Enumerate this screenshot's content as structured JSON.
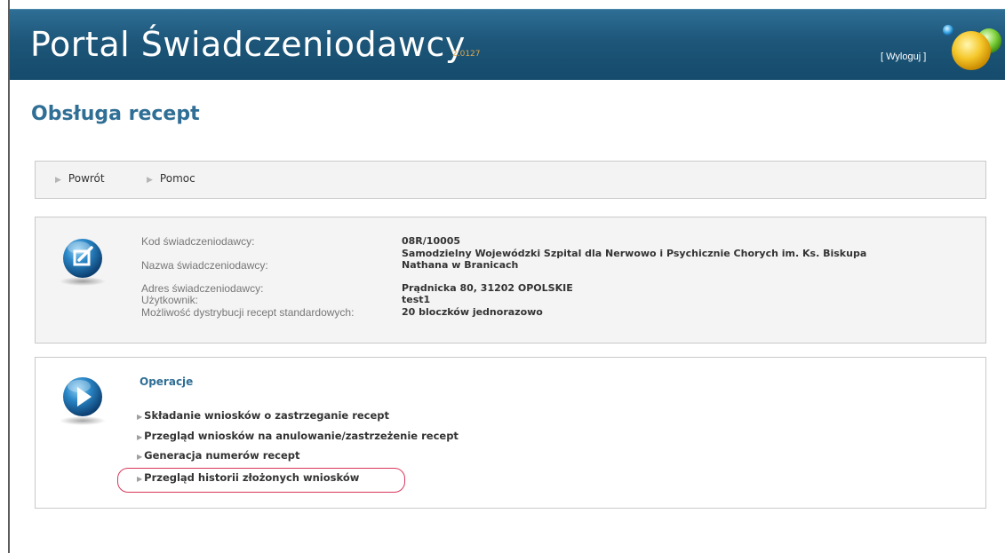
{
  "header": {
    "title": "Portal Świadczeniodawcy",
    "version": "2.0127",
    "logout_label": "[ Wyloguj ]",
    "color": "#1d5679"
  },
  "page": {
    "title": "Obsługa recept"
  },
  "nav": {
    "back_label": "Powrót",
    "help_label": "Pomoc"
  },
  "info": {
    "icon": "edit-document-icon",
    "rows": [
      {
        "label": "Kod świadczeniodawcy:",
        "value": "08R/10005"
      },
      {
        "label": "Nazwa świadczeniodawcy:",
        "value": "Samodzielny Wojewódzki Szpital dla Nerwowo i Psychicznie Chorych im. Ks. Biskupa",
        "value2": "Nathana w Branicach"
      },
      {
        "label": "Adres świadczeniodawcy:",
        "value": "Prądnicka 80, 31202 OPOLSKIE"
      },
      {
        "label": "Użytkownik:",
        "value": "test1"
      },
      {
        "label": "Możliwość dystrybucji recept standardowych:",
        "value": "20 bloczków jednorazowo"
      }
    ]
  },
  "operations": {
    "icon": "play-icon",
    "heading": "Operacje",
    "items": [
      {
        "label": "Składanie wniosków o zastrzeganie recept"
      },
      {
        "label": "Przegląd wniosków na anulowanie/zastrzeżenie recept"
      },
      {
        "label": "Generacja numerów recept"
      },
      {
        "label": "Przegląd historii złożonych wniosków",
        "highlighted": true
      }
    ],
    "highlight_color": "#d9385c"
  }
}
